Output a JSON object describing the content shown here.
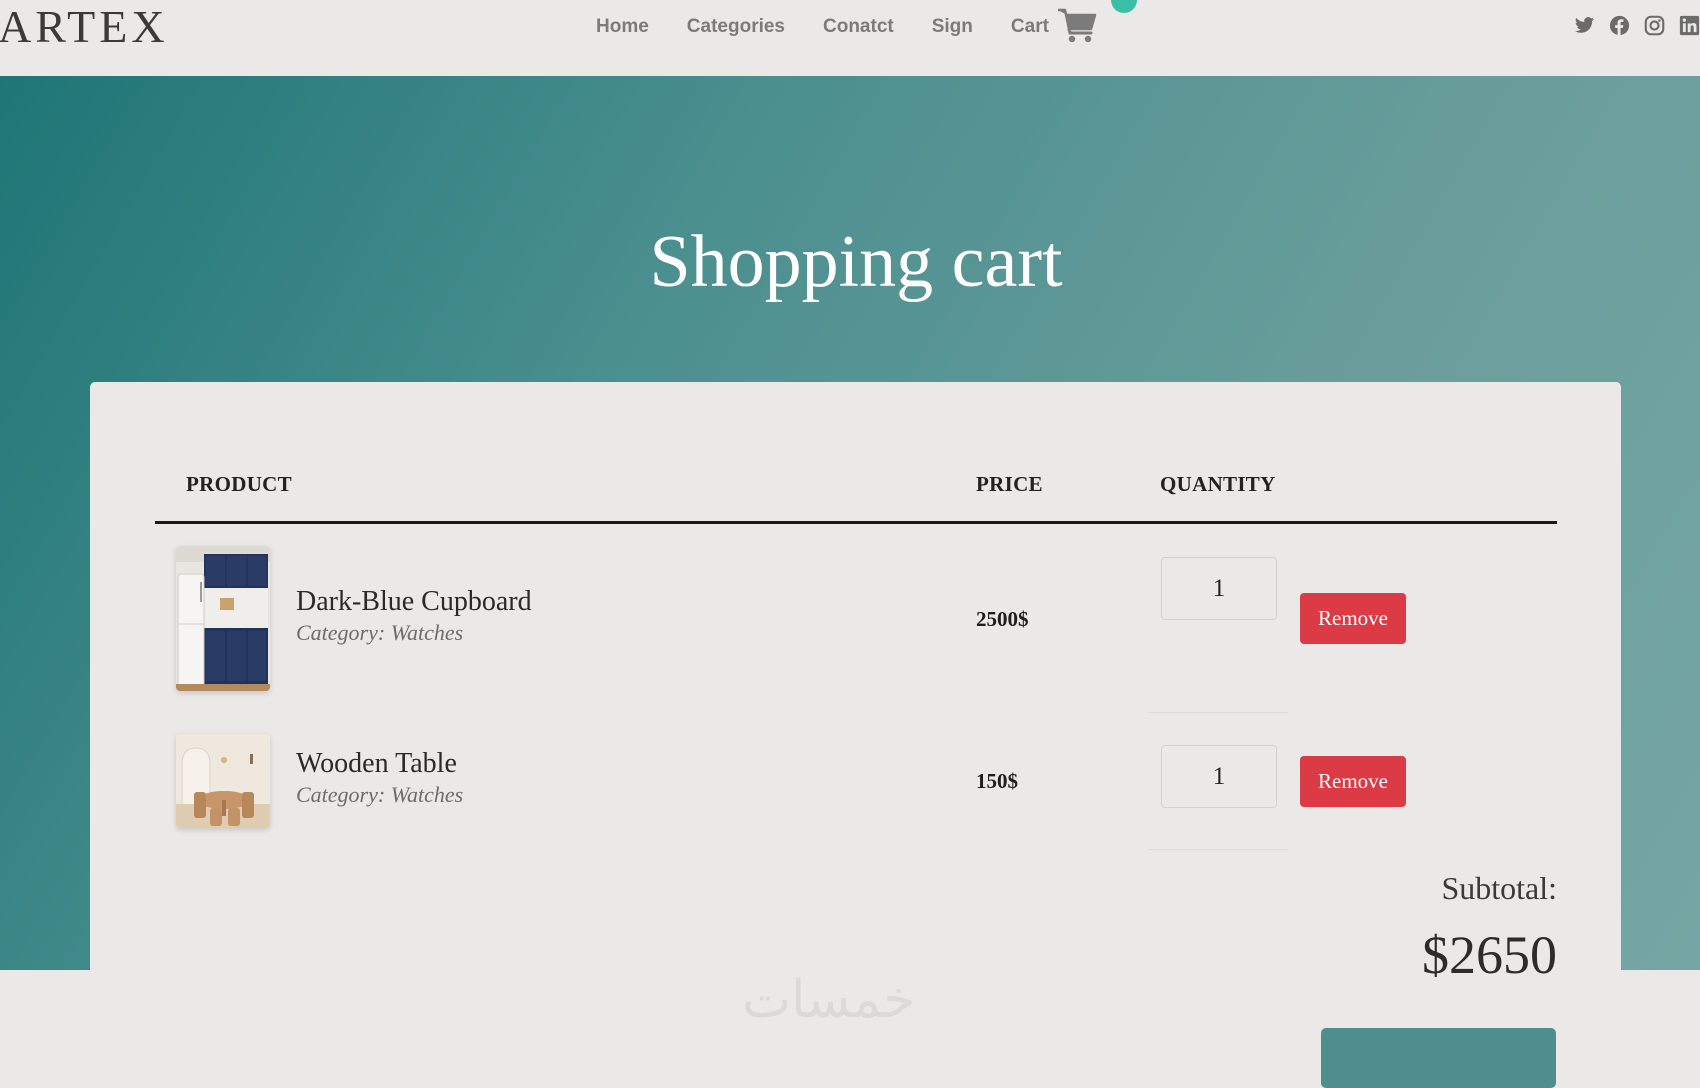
{
  "navbar": {
    "brand": "ARTEX",
    "links": [
      "Home",
      "Categories",
      "Conatct",
      "Sign"
    ],
    "cart_label": "Cart"
  },
  "social": [
    "twitter-icon",
    "facebook-icon",
    "instagram-icon",
    "linkedin-icon"
  ],
  "hero": {
    "title": "Shopping cart"
  },
  "table": {
    "headers": {
      "product": "PRODUCT",
      "price": "PRICE",
      "quantity": "QUANTITY"
    },
    "rows": [
      {
        "name": "Dark-Blue Cupboard",
        "category": "Category: Watches",
        "price": "2500$",
        "quantity": "1",
        "remove_label": "Remove"
      },
      {
        "name": "Wooden Table",
        "category": "Category: Watches",
        "price": "150$",
        "quantity": "1",
        "remove_label": "Remove"
      }
    ]
  },
  "summary": {
    "subtotal_label": "Subtotal:",
    "subtotal_value": "$2650"
  },
  "watermark": "خمسات",
  "colors": {
    "accent": "#3dbfa7",
    "remove": "#dc3b45",
    "hero_start": "#1f7576",
    "hero_end": "#76a6a3"
  }
}
